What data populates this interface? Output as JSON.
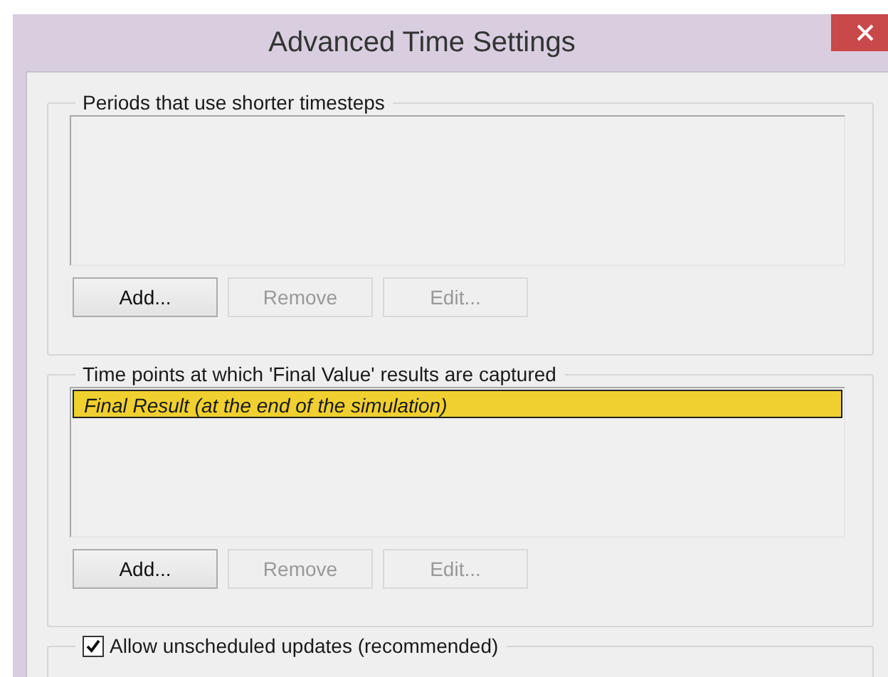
{
  "window": {
    "title": "Advanced Time Settings"
  },
  "groups": [
    {
      "label": "Periods that use shorter timesteps",
      "buttons": [
        {
          "label": "Add...",
          "disabled": false
        },
        {
          "label": "Remove",
          "disabled": true
        },
        {
          "label": "Edit...",
          "disabled": true
        }
      ]
    },
    {
      "label": "Time points at which 'Final Value' results are captured",
      "items": [
        {
          "text": "Final Result (at the end of the simulation)",
          "selected": true
        }
      ],
      "buttons": [
        {
          "label": "Add...",
          "disabled": false
        },
        {
          "label": "Remove",
          "disabled": true
        },
        {
          "label": "Edit...",
          "disabled": true
        }
      ]
    }
  ],
  "unscheduled_updates": {
    "label": "Allow unscheduled updates (recommended)",
    "checked": true
  }
}
